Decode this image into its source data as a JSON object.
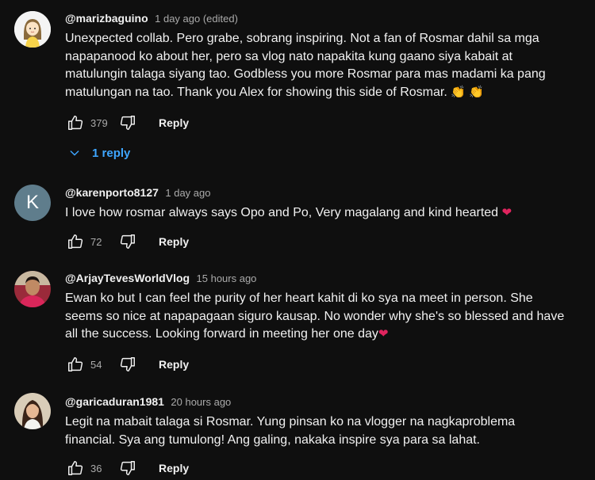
{
  "comments": [
    {
      "handle": "@marizbaguino",
      "time": "1 day ago (edited)",
      "text": "Unexpected collab. Pero grabe, sobrang inspiring. Not a fan of Rosmar dahil sa mga napapanood ko about her, pero sa vlog nato napakita kung gaano siya kabait at matulungin talaga siyang tao. Godbless you more Rosmar para mas madami ka pang matulungan na tao. Thank you Alex for showing this side of Rosmar.",
      "emoji": "👏 👏",
      "likes": "379",
      "reply_label": "Reply",
      "replies_label": "1 reply",
      "avatar": "cartoon-girl"
    },
    {
      "handle": "@karenporto8127",
      "time": "1 day ago",
      "text": "I love how rosmar always says Opo and Po, Very magalang and kind hearted",
      "emoji": "❤",
      "likes": "72",
      "reply_label": "Reply",
      "avatar_letter": "K",
      "avatar_color": "#5f7d8c"
    },
    {
      "handle": "@ArjayTevesWorldVlog",
      "time": "15 hours ago",
      "text": "Ewan ko but I can feel the purity of her heart kahit di ko sya na meet in person. She seems so nice at napapagaan siguro kausap. No wonder why she's so blessed and have all the success. Looking forward in meeting her one day",
      "emoji": "❤",
      "likes": "54",
      "reply_label": "Reply",
      "avatar": "man-photo"
    },
    {
      "handle": "@garicaduran1981",
      "time": "20 hours ago",
      "text": "Legit na mabait talaga si Rosmar. Yung pinsan ko na vlogger na nagkaproblema financial. Sya ang tumulong! Ang galing, nakaka inspire sya para sa lahat.",
      "likes": "36",
      "reply_label": "Reply",
      "avatar": "woman-photo"
    }
  ],
  "colors": {
    "background": "#0f0f0f",
    "text": "#f1f1f1",
    "secondary_text": "#aaaaaa",
    "link_blue": "#3ea6ff"
  },
  "icons": [
    "thumbs-up-icon",
    "thumbs-down-icon",
    "chevron-down-icon"
  ]
}
